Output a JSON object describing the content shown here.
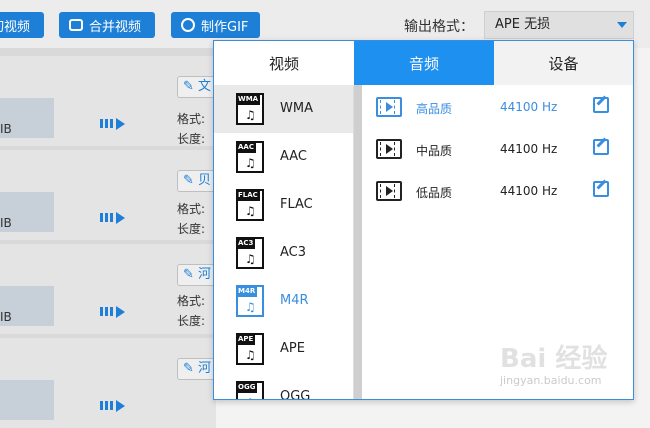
{
  "toolbar": {
    "btn1_label": "剪切视频",
    "btn2_label": "合并视频",
    "btn3_label": "制作GIF"
  },
  "output": {
    "label": "输出格式：",
    "selected": "APE  无损"
  },
  "bg_rows": [
    {
      "edit": "✎ 文",
      "size": "IB",
      "meta1": "格式:",
      "meta2": "长度:"
    },
    {
      "edit": "✎ 贝",
      "size": "IB",
      "meta1": "格式:",
      "meta2": "长度:"
    },
    {
      "edit": "✎ 河",
      "size": "IB",
      "meta1": "格式:",
      "meta2": "长度:"
    },
    {
      "edit": "✎ 河",
      "size": "",
      "meta1": "",
      "meta2": ""
    }
  ],
  "panel": {
    "tabs": {
      "video": "视频",
      "audio": "音频",
      "device": "设备"
    },
    "formats": [
      {
        "tag": "WMA",
        "name": "WMA"
      },
      {
        "tag": "AAC",
        "name": "AAC"
      },
      {
        "tag": "FLAC",
        "name": "FLAC"
      },
      {
        "tag": "AC3",
        "name": "AC3"
      },
      {
        "tag": "M4R",
        "name": "M4R"
      },
      {
        "tag": "APE",
        "name": "APE"
      },
      {
        "tag": "OGG",
        "name": "OGG"
      }
    ],
    "qualities": [
      {
        "name": "高品质",
        "rate": "44100 Hz"
      },
      {
        "name": "中品质",
        "rate": "44100 Hz"
      },
      {
        "name": "低品质",
        "rate": "44100 Hz"
      }
    ]
  },
  "watermark": {
    "text": "Bai 经验",
    "sub": "jingyan.baidu.com"
  },
  "colors": {
    "accent": "#1e90f0",
    "highlight": "#3a8ee0"
  }
}
